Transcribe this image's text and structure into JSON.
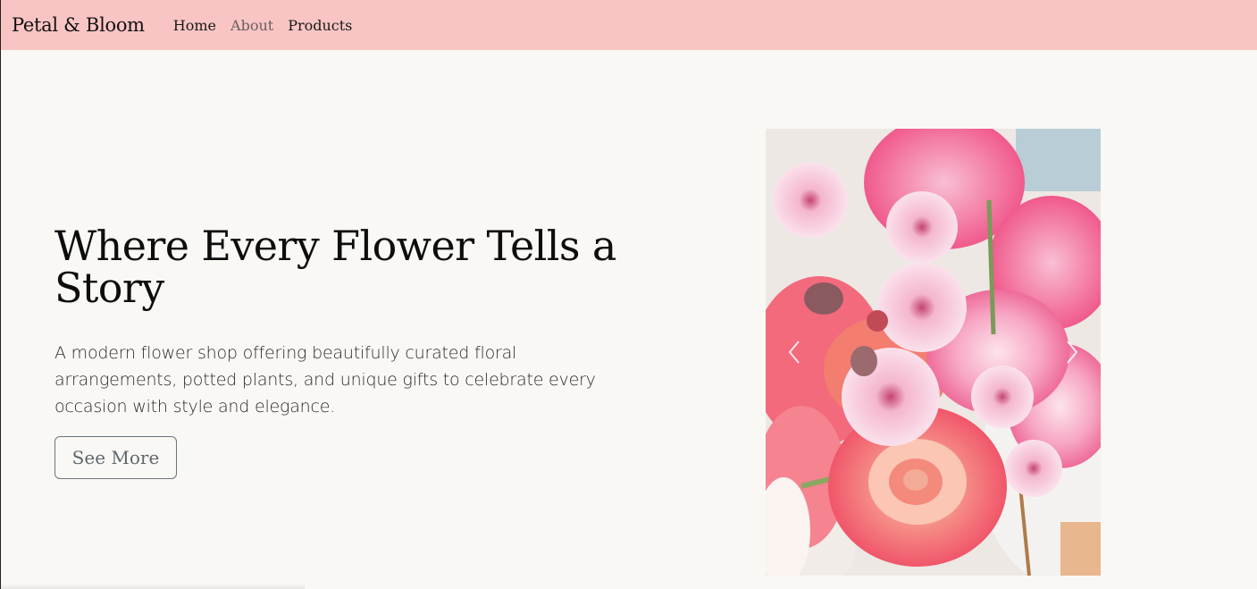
{
  "navbar": {
    "brand": "Petal & Bloom",
    "links": [
      {
        "label": "Home",
        "active": true
      },
      {
        "label": "About",
        "active": false
      },
      {
        "label": "Products",
        "active": false
      }
    ],
    "bg_color": "#f9c5c4"
  },
  "hero": {
    "title": "Where Every Flower Tells a Story",
    "description": "A modern flower shop offering beautifully curated floral arrangements, potted plants, and unique gifts to celebrate every occasion with style and elegance.",
    "button_label": "See More"
  },
  "carousel": {
    "prev_icon": "chevron-left-icon",
    "next_icon": "chevron-right-icon",
    "image": "pink-flowers-bouquet"
  }
}
